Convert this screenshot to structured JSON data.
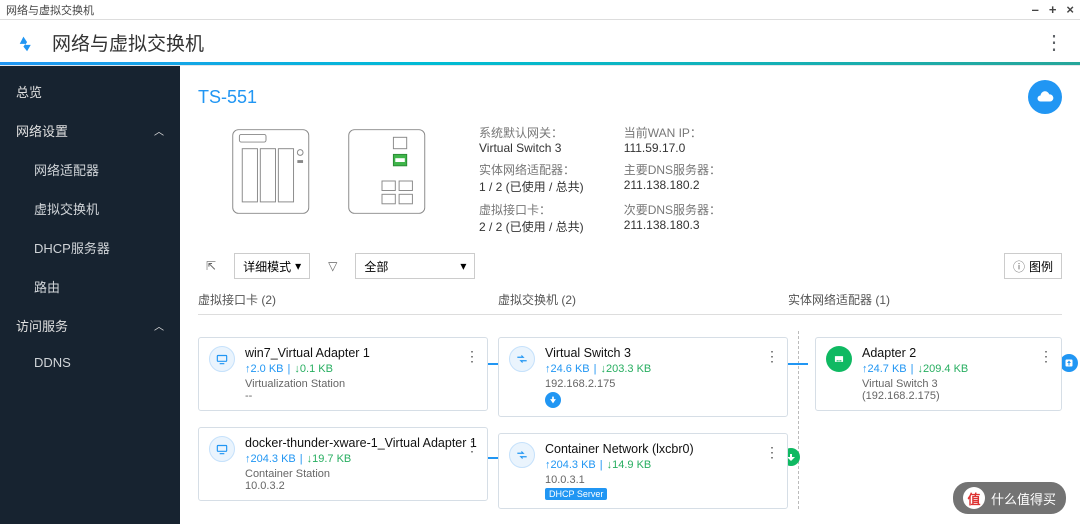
{
  "window": {
    "title": "网络与虚拟交换机"
  },
  "app": {
    "title": "网络与虚拟交换机"
  },
  "sidebar": {
    "items": [
      {
        "label": "总览"
      },
      {
        "label": "网络设置",
        "expanded": true
      },
      {
        "label": "网络适配器"
      },
      {
        "label": "虚拟交换机"
      },
      {
        "label": "DHCP服务器"
      },
      {
        "label": "路由"
      },
      {
        "label": "访问服务",
        "expanded": true
      },
      {
        "label": "DDNS"
      }
    ]
  },
  "device": {
    "model": "TS-551"
  },
  "info": {
    "gateway_label": "系统默认网关：",
    "gateway_value": "Virtual Switch 3",
    "wan_label": "当前WAN IP：",
    "wan_value": "111.59.17.0",
    "adapter_label": "实体网络适配器：",
    "adapter_value": "1 / 2 (已使用 / 总共)",
    "dns1_label": "主要DNS服务器：",
    "dns1_value": "211.138.180.2",
    "vnic_label": "虚拟接口卡：",
    "vnic_value": "2 / 2 (已使用 / 总共)",
    "dns2_label": "次要DNS服务器：",
    "dns2_value": "211.138.180.3"
  },
  "toolbar": {
    "mode_label": "详细模式",
    "filter_label": "全部",
    "legend_label": "图例"
  },
  "columns": {
    "col1_header": "虚拟接口卡 (2)",
    "col2_header": "虚拟交换机 (2)",
    "col3_header": "实体网络适配器 (1)"
  },
  "cards": {
    "va1": {
      "title": "win7_Virtual Adapter 1",
      "up": "2.0 KB",
      "down": "0.1 KB",
      "sub1": "Virtualization Station",
      "sub2": "--"
    },
    "va2": {
      "title": "docker-thunder-xware-1_Virtual Adapter 1",
      "up": "204.3 KB",
      "down": "19.7 KB",
      "sub1": "Container Station",
      "sub2": "10.0.3.2"
    },
    "vs1": {
      "title": "Virtual Switch 3",
      "up": "24.6 KB",
      "down": "203.3 KB",
      "sub1": "192.168.2.175"
    },
    "vs2": {
      "title": "Container Network (lxcbr0)",
      "up": "204.3 KB",
      "down": "14.9 KB",
      "sub1": "10.0.3.1",
      "dhcp": "DHCP Server"
    },
    "na1": {
      "title": "Adapter 2",
      "up": "24.7 KB",
      "down": "209.4 KB",
      "sub1": "Virtual Switch 3",
      "sub2": "(192.168.2.175)"
    }
  },
  "watermark": {
    "text": "什么值得买",
    "badge": "值"
  }
}
